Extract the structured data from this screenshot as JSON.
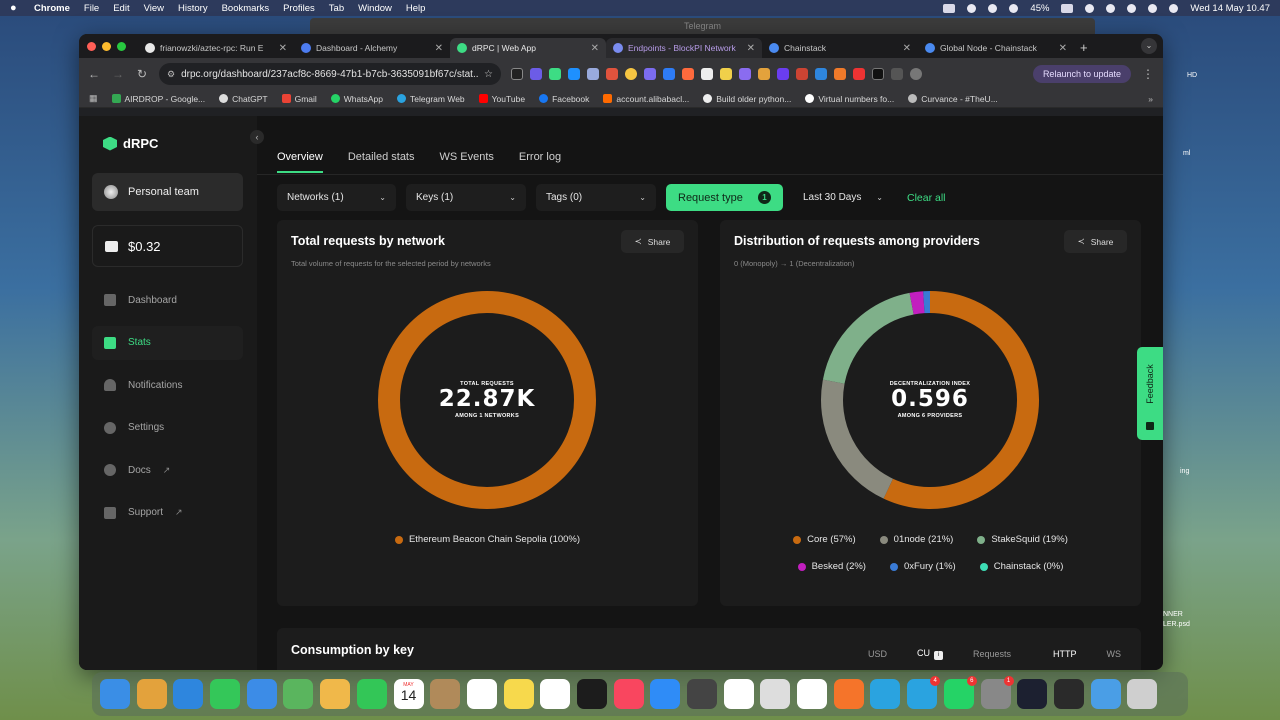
{
  "menubar": {
    "app": "Chrome",
    "items": [
      "File",
      "Edit",
      "View",
      "History",
      "Bookmarks",
      "Profiles",
      "Tab",
      "Window",
      "Help"
    ],
    "battery": "45%",
    "datetime": "Wed 14 May  10.47"
  },
  "ghost_window_title": "Telegram",
  "tabs": [
    {
      "title": "frianowzki/aztec-rpc: Run E",
      "color": "#e8e8e8"
    },
    {
      "title": "Dashboard - Alchemy",
      "color": "#4d7cf0"
    },
    {
      "title": "dRPC | Web App",
      "color": "#3ddc84"
    },
    {
      "title": "Endpoints - BlockPI Network",
      "color": "#7a8cf0"
    },
    {
      "title": "Chainstack",
      "color": "#4a8af0"
    },
    {
      "title": "Global Node - Chainstack",
      "color": "#4a8af0"
    }
  ],
  "address_bar": {
    "url": "drpc.org/dashboard/237acf8c-8669-47b1-b7cb-3635091bf67c/stat..."
  },
  "relaunch_label": "Relaunch to update",
  "bookmarks": [
    {
      "label": "AIRDROP - Google...",
      "color": "#34a853"
    },
    {
      "label": "ChatGPT",
      "color": "#dddddd"
    },
    {
      "label": "Gmail",
      "color": "#ea4335"
    },
    {
      "label": "WhatsApp",
      "color": "#25d366"
    },
    {
      "label": "Telegram Web",
      "color": "#2aa3e0"
    },
    {
      "label": "YouTube",
      "color": "#ff0000"
    },
    {
      "label": "Facebook",
      "color": "#1877f2"
    },
    {
      "label": "account.alibabacl...",
      "color": "#ff6a00"
    },
    {
      "label": "Build older python...",
      "color": "#eeeeee"
    },
    {
      "label": "Virtual numbers fo...",
      "color": "#ffffff"
    },
    {
      "label": "Curvance - #TheU...",
      "color": "#bbbbbb"
    }
  ],
  "sidebar": {
    "brand": "dRPC",
    "team": "Personal team",
    "balance": "$0.32",
    "items": [
      {
        "label": "Dashboard",
        "active": false
      },
      {
        "label": "Stats",
        "active": true
      },
      {
        "label": "Notifications",
        "active": false
      },
      {
        "label": "Settings",
        "active": false
      },
      {
        "label": "Docs",
        "active": false,
        "external": true
      },
      {
        "label": "Support",
        "active": false,
        "external": true
      }
    ]
  },
  "subtabs": [
    "Overview",
    "Detailed stats",
    "WS Events",
    "Error log"
  ],
  "filters": {
    "networks": "Networks (1)",
    "keys": "Keys (1)",
    "tags": "Tags (0)",
    "request_type": "Request type",
    "request_type_count": "1",
    "period": "Last 30 Days",
    "clear": "Clear all"
  },
  "card_network": {
    "title": "Total requests by network",
    "subtitle": "Total volume of requests for the selected period by networks",
    "share": "Share",
    "center_label": "TOTAL REQUESTS",
    "center_value": "22.87K",
    "center_sub": "AMONG 1 NETWORKS",
    "legend": [
      {
        "label": "Ethereum Beacon Chain Sepolia (100%)",
        "color": "#c86a10"
      }
    ]
  },
  "card_providers": {
    "title": "Distribution of requests among providers",
    "subtitle": "0 (Monopoly) → 1 (Decentralization)",
    "share": "Share",
    "center_label": "DECENTRALIZATION INDEX",
    "center_value": "0.596",
    "center_sub": "AMONG 6 PROVIDERS",
    "legend": [
      {
        "label": "Core (57%)",
        "color": "#c86a10"
      },
      {
        "label": "01node (21%)",
        "color": "#8a8a7e"
      },
      {
        "label": "StakeSquid (19%)",
        "color": "#7fb08a"
      },
      {
        "label": "Besked (2%)",
        "color": "#c21fbf"
      },
      {
        "label": "0xFury (1%)",
        "color": "#3a7bd5"
      },
      {
        "label": "Chainstack (0%)",
        "color": "#3ddcb4"
      }
    ]
  },
  "chart_data": [
    {
      "type": "pie",
      "title": "Total requests by network",
      "categories": [
        "Ethereum Beacon Chain Sepolia"
      ],
      "values": [
        100
      ],
      "total": "22.87K"
    },
    {
      "type": "pie",
      "title": "Distribution of requests among providers",
      "categories": [
        "Core",
        "01node",
        "StakeSquid",
        "Besked",
        "0xFury",
        "Chainstack"
      ],
      "values": [
        57,
        21,
        19,
        2,
        1,
        0
      ],
      "colors": [
        "#c86a10",
        "#8a8a7e",
        "#7fb08a",
        "#c21fbf",
        "#3a7bd5",
        "#3ddcb4"
      ],
      "index": "0.596"
    }
  ],
  "consumption": {
    "title": "Consumption by key",
    "units": [
      "USD",
      "CU",
      "Requests"
    ],
    "unit_badge": "i",
    "protocols": [
      "HTTP",
      "WS"
    ]
  },
  "feedback_label": "Feedback",
  "desktop_labels": [
    "HD",
    "ml",
    "ing",
    "NNER",
    "LER.psd"
  ],
  "dock": [
    {
      "name": "finder",
      "color": "#3a8ee6"
    },
    {
      "name": "launchpad",
      "color": "#e3a23c"
    },
    {
      "name": "safari",
      "color": "#2e86de"
    },
    {
      "name": "messages",
      "color": "#34c759"
    },
    {
      "name": "mail",
      "color": "#3c8ce7"
    },
    {
      "name": "maps",
      "color": "#5ab55e"
    },
    {
      "name": "photos",
      "color": "#f0b84a"
    },
    {
      "name": "facetime",
      "color": "#33c657"
    },
    {
      "name": "calendar",
      "color": "#ffffff"
    },
    {
      "name": "contacts",
      "color": "#b08a5a"
    },
    {
      "name": "reminders",
      "color": "#ffffff"
    },
    {
      "name": "notes",
      "color": "#f7d94c"
    },
    {
      "name": "freeform",
      "color": "#ffffff"
    },
    {
      "name": "apple-tv",
      "color": "#1c1c1c"
    },
    {
      "name": "music",
      "color": "#f9465f"
    },
    {
      "name": "app-store",
      "color": "#2f8cf7"
    },
    {
      "name": "activity",
      "color": "#444444"
    },
    {
      "name": "chatgpt",
      "color": "#ffffff"
    },
    {
      "name": "preview",
      "color": "#dddddd"
    },
    {
      "name": "chrome",
      "color": "#ffffff"
    },
    {
      "name": "firefox",
      "color": "#f5742a"
    },
    {
      "name": "telegram",
      "color": "#2aa3e0"
    },
    {
      "name": "telegram-2",
      "color": "#2aa3e0",
      "badge": "4"
    },
    {
      "name": "whatsapp",
      "color": "#25d366",
      "badge": "6"
    },
    {
      "name": "system-settings",
      "color": "#888888",
      "badge": "1"
    },
    {
      "name": "cloud-app",
      "color": "#1c2030"
    },
    {
      "name": "obs",
      "color": "#2a2a2a"
    },
    {
      "name": "downloads",
      "color": "#4a9ee6"
    },
    {
      "name": "trash",
      "color": "#cfcfcf"
    }
  ],
  "calendar_icon": {
    "month": "MAY",
    "day": "14"
  }
}
